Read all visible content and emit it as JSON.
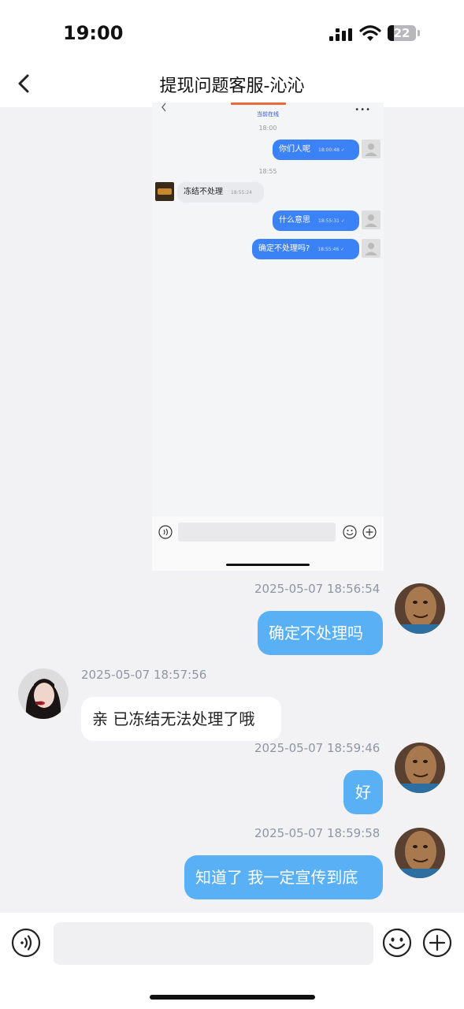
{
  "status_bar": {
    "time": "19:00",
    "battery": "22",
    "battery_level": 0.22,
    "icons": [
      "signal-icon",
      "wifi-icon",
      "battery-icon"
    ]
  },
  "nav": {
    "title": "提现问题客服-沁沁",
    "back_icon": "chevron-left-icon"
  },
  "embedded_screenshot": {
    "header_status": "当前在线",
    "messages": [
      {
        "type": "time",
        "text": "18:00"
      },
      {
        "type": "out",
        "text": "你们人呢",
        "time": "18:00:48 ✓"
      },
      {
        "type": "time",
        "text": "18:55"
      },
      {
        "type": "in",
        "text": "冻结不处理",
        "time": "18:55:24"
      },
      {
        "type": "out",
        "text": "什么意思",
        "time": "18:55:31 ✓"
      },
      {
        "type": "out",
        "text": "确定不处理吗?",
        "time": "18:55:46 ✓"
      }
    ]
  },
  "chat": {
    "messages": [
      {
        "direction": "out",
        "timestamp": "2025-05-07 18:56:54",
        "text": "确定不处理吗"
      },
      {
        "direction": "in",
        "timestamp": "2025-05-07 18:57:56",
        "text": "亲 已冻结无法处理了哦"
      },
      {
        "direction": "out",
        "timestamp": "2025-05-07 18:59:46",
        "text": "好"
      },
      {
        "direction": "out",
        "timestamp": "2025-05-07 18:59:58",
        "text": "知道了 我一定宣传到底"
      }
    ]
  },
  "input_bar": {
    "placeholder": "",
    "icons": [
      "voice-icon",
      "emoji-icon",
      "plus-icon"
    ]
  },
  "colors": {
    "outgoing_bubble": "#5ab0f5",
    "incoming_bubble": "#ffffff",
    "background": "#f2f2f5",
    "timestamp": "#8e96a5"
  }
}
